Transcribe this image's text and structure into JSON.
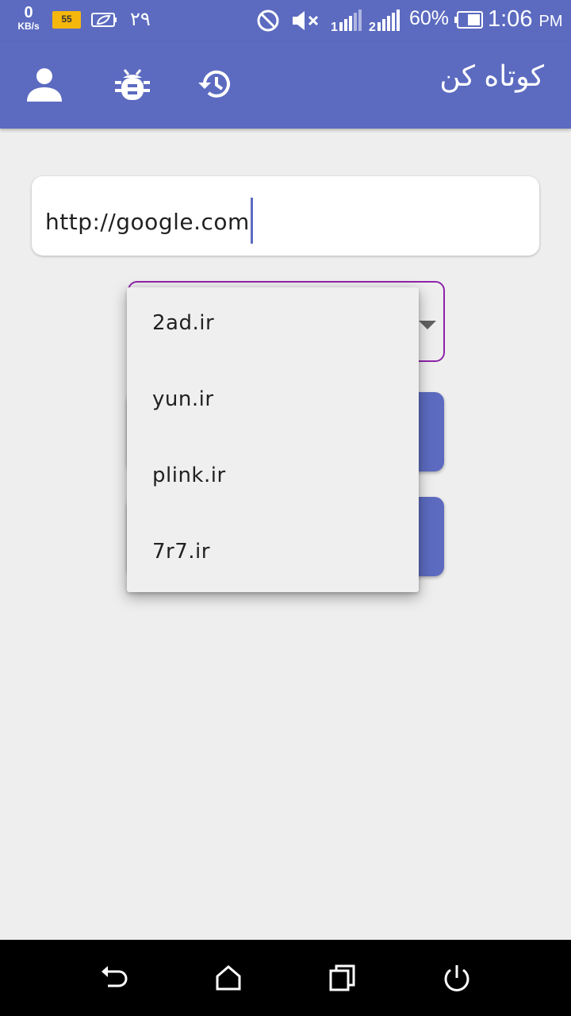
{
  "status_bar": {
    "speed_value": "0",
    "speed_unit": "KB/s",
    "badge_text": "55",
    "date": "۲۹",
    "sim1_label": "1",
    "sim2_label": "2",
    "battery_percent": "60%",
    "time": "1:06",
    "ampm": "PM"
  },
  "app_bar": {
    "title": "کوتاه کن",
    "icons": [
      "account-icon",
      "bug-icon",
      "history-icon"
    ],
    "color": "#5c6bc0"
  },
  "url_input": {
    "value": "http://google.com"
  },
  "domain_select": {
    "options": [
      "2ad.ir",
      "yun.ir",
      "plink.ir",
      "7r7.ir"
    ],
    "border_color": "#8e24aa"
  },
  "nav_bar": {
    "icons": [
      "back-icon",
      "home-icon",
      "recents-icon",
      "power-icon"
    ]
  }
}
